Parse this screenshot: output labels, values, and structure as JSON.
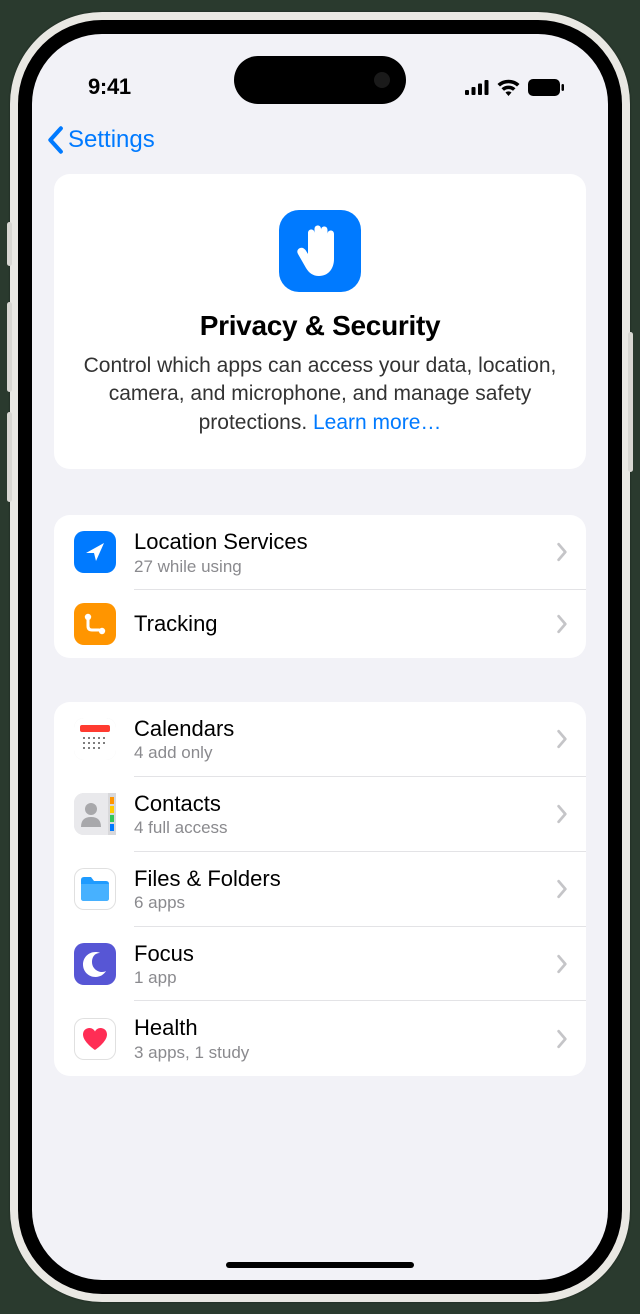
{
  "status": {
    "time": "9:41"
  },
  "nav": {
    "back_label": "Settings"
  },
  "hero": {
    "title": "Privacy & Security",
    "description": "Control which apps can access your data, location, camera, and microphone, and manage safety protections. ",
    "learn_more": "Learn more…"
  },
  "section1": [
    {
      "title": "Location Services",
      "sub": "27 while using",
      "icon": "location-arrow",
      "icon_class": "bg-blue"
    },
    {
      "title": "Tracking",
      "sub": "",
      "icon": "tracking",
      "icon_class": "bg-orange"
    }
  ],
  "section2": [
    {
      "title": "Calendars",
      "sub": "4 add only",
      "icon": "calendar",
      "icon_class": "bg-white-b"
    },
    {
      "title": "Contacts",
      "sub": "4 full access",
      "icon": "contacts",
      "icon_class": "bg-lgray"
    },
    {
      "title": "Files & Folders",
      "sub": "6 apps",
      "icon": "folder",
      "icon_class": "bg-blue"
    },
    {
      "title": "Focus",
      "sub": "1 app",
      "icon": "moon",
      "icon_class": "bg-purple"
    },
    {
      "title": "Health",
      "sub": "3 apps, 1 study",
      "icon": "heart",
      "icon_class": "bg-white-b"
    }
  ]
}
